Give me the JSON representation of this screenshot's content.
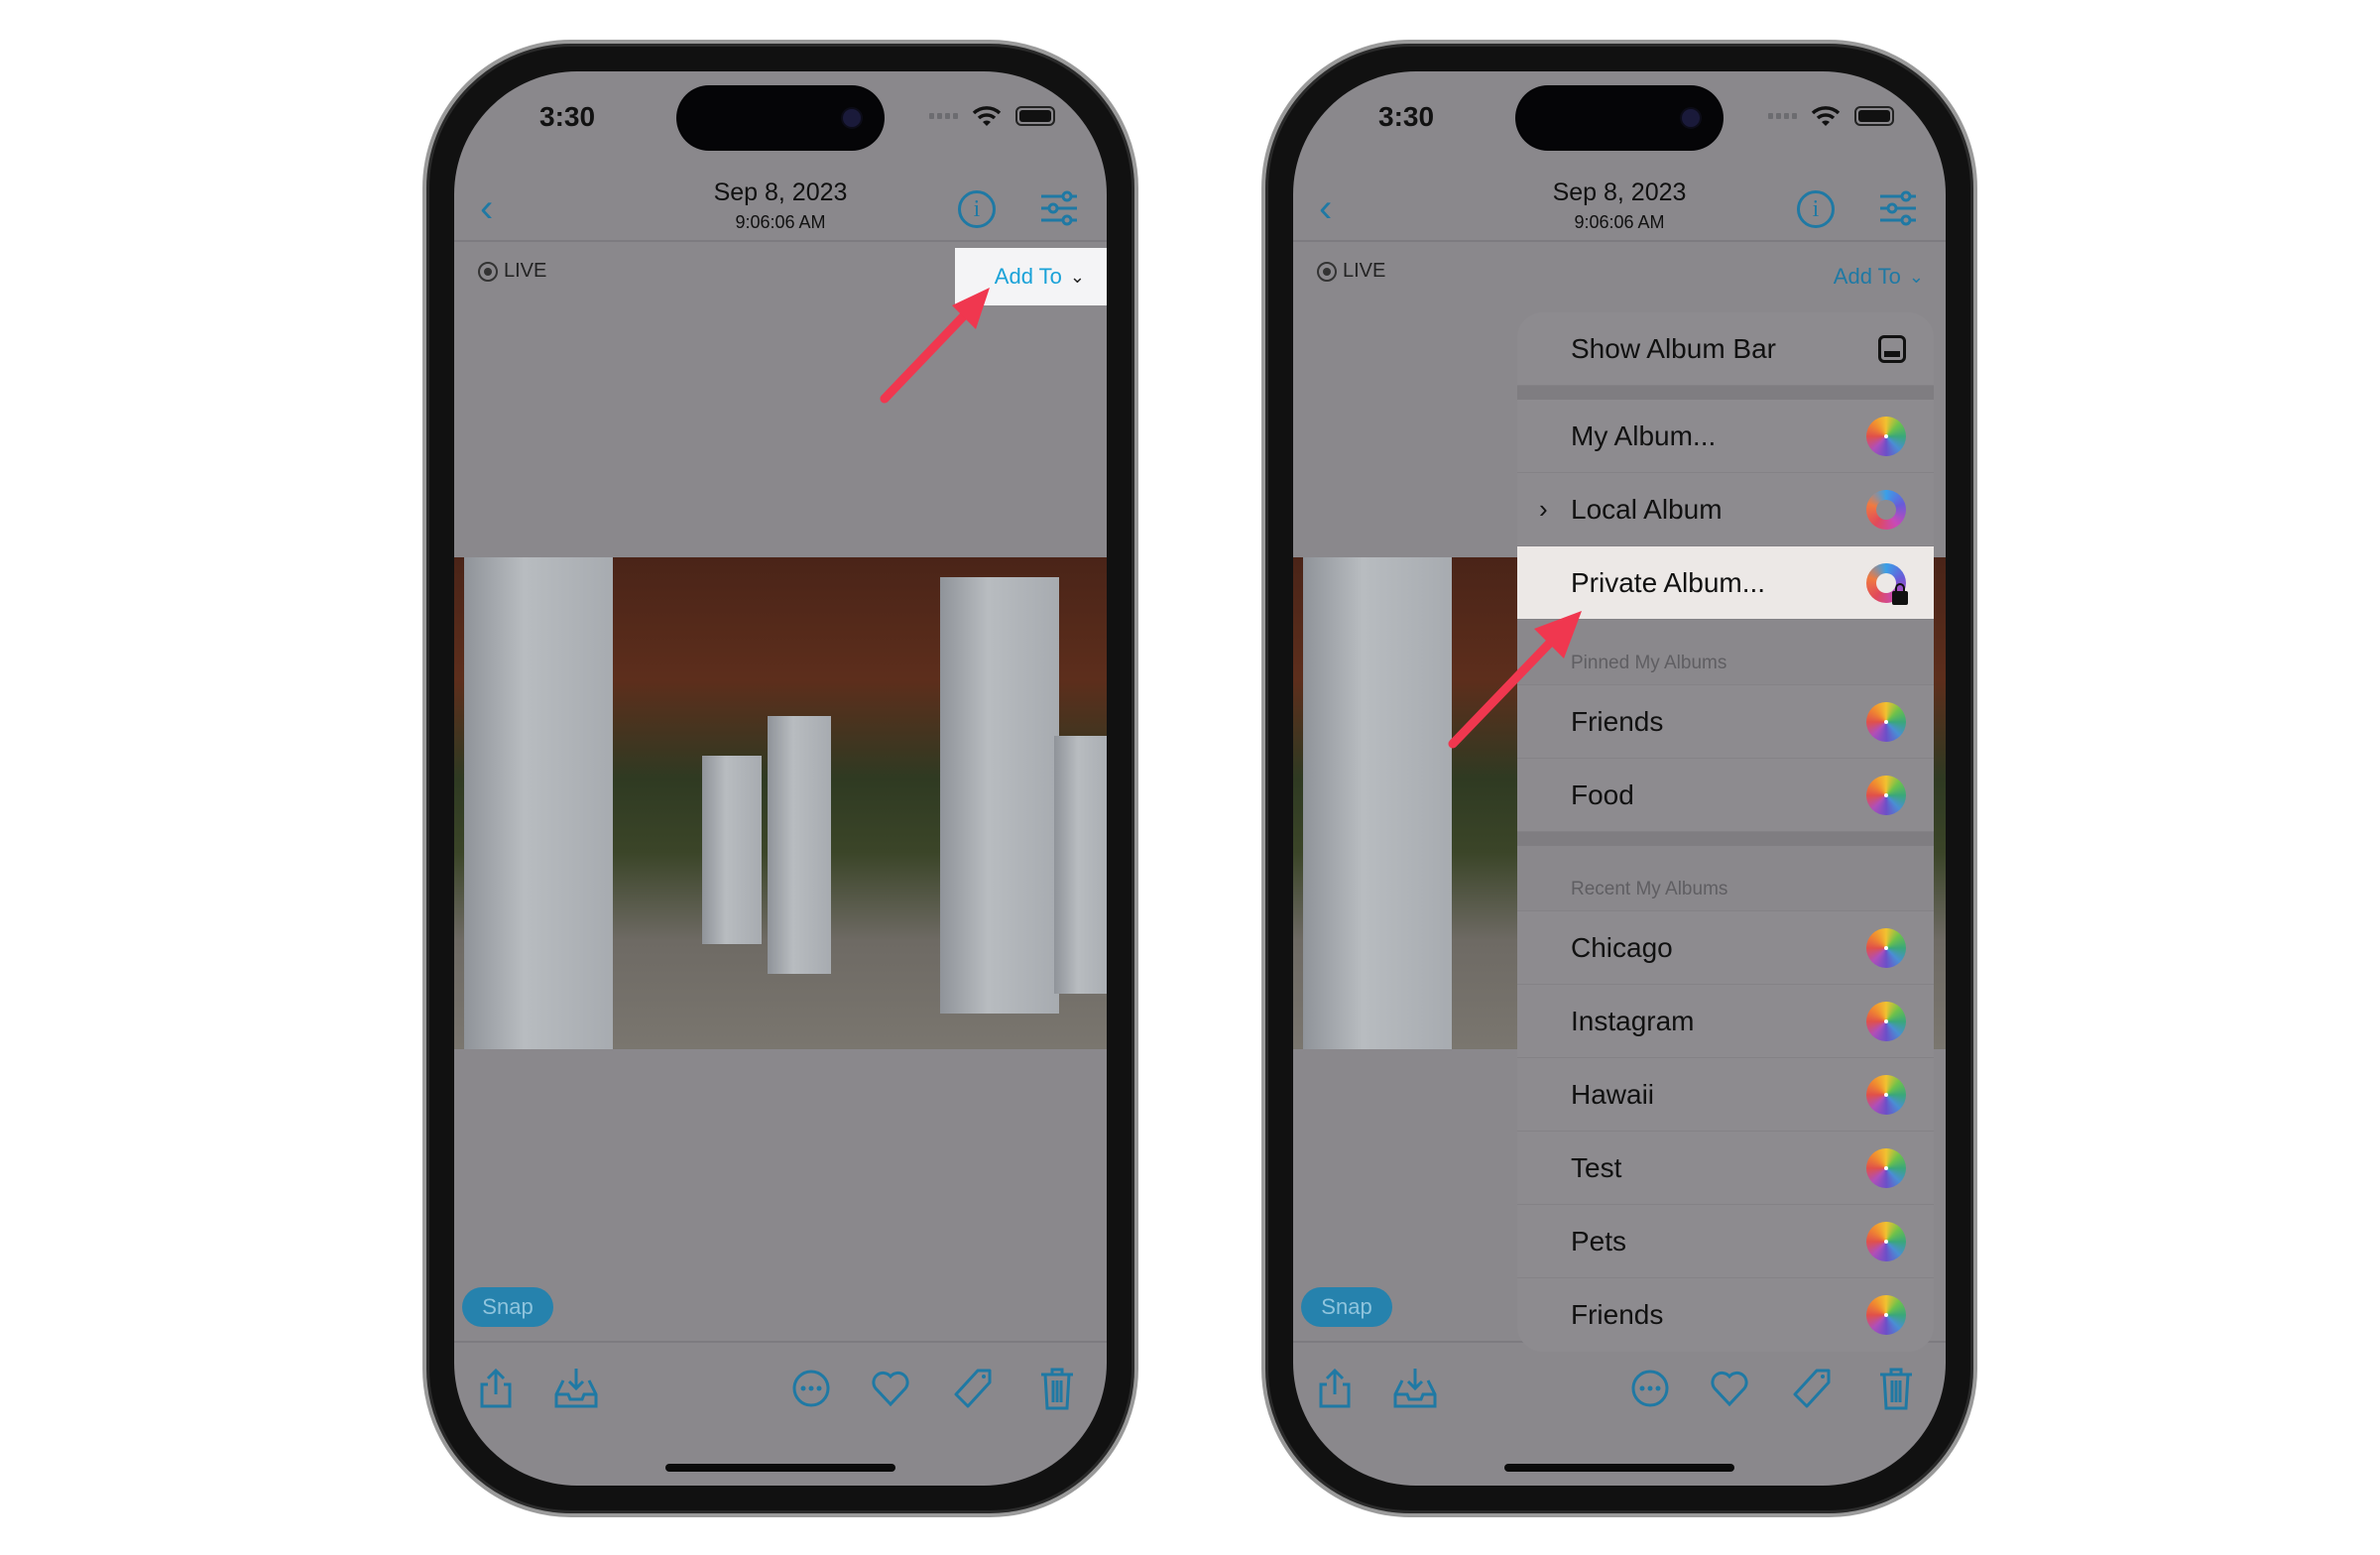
{
  "status": {
    "time": "3:30"
  },
  "nav": {
    "title": "Sep 8, 2023",
    "subtitle": "9:06:06 AM",
    "back_icon": "chevron-left-icon",
    "info_icon": "info-icon",
    "adjust_icon": "sliders-icon"
  },
  "live_label": "LIVE",
  "add_to_label": "Add To",
  "snap_label": "Snap",
  "toolbar": [
    "share-icon",
    "save-to-tray-icon",
    "more-icon",
    "heart-icon",
    "tag-icon",
    "trash-icon"
  ],
  "menu": {
    "show_album_bar": "Show Album Bar",
    "items_top": [
      {
        "label": "My Album...",
        "icon": "photos-flower-icon"
      },
      {
        "label": "Local Album",
        "icon": "local-album-ring-icon",
        "submenu": true
      },
      {
        "label": "Private Album...",
        "icon": "private-album-lock-icon",
        "highlighted": true
      }
    ],
    "pinned_header": "Pinned My Albums",
    "pinned": [
      "Friends",
      "Food"
    ],
    "recent_header": "Recent My Albums",
    "recent": [
      "Chicago",
      "Instagram",
      "Hawaii",
      "Test",
      "Pets",
      "Friends"
    ]
  },
  "colors": {
    "accent": "#1f79a4",
    "arrow": "#f0374f",
    "highlight": "#ece8e6"
  }
}
